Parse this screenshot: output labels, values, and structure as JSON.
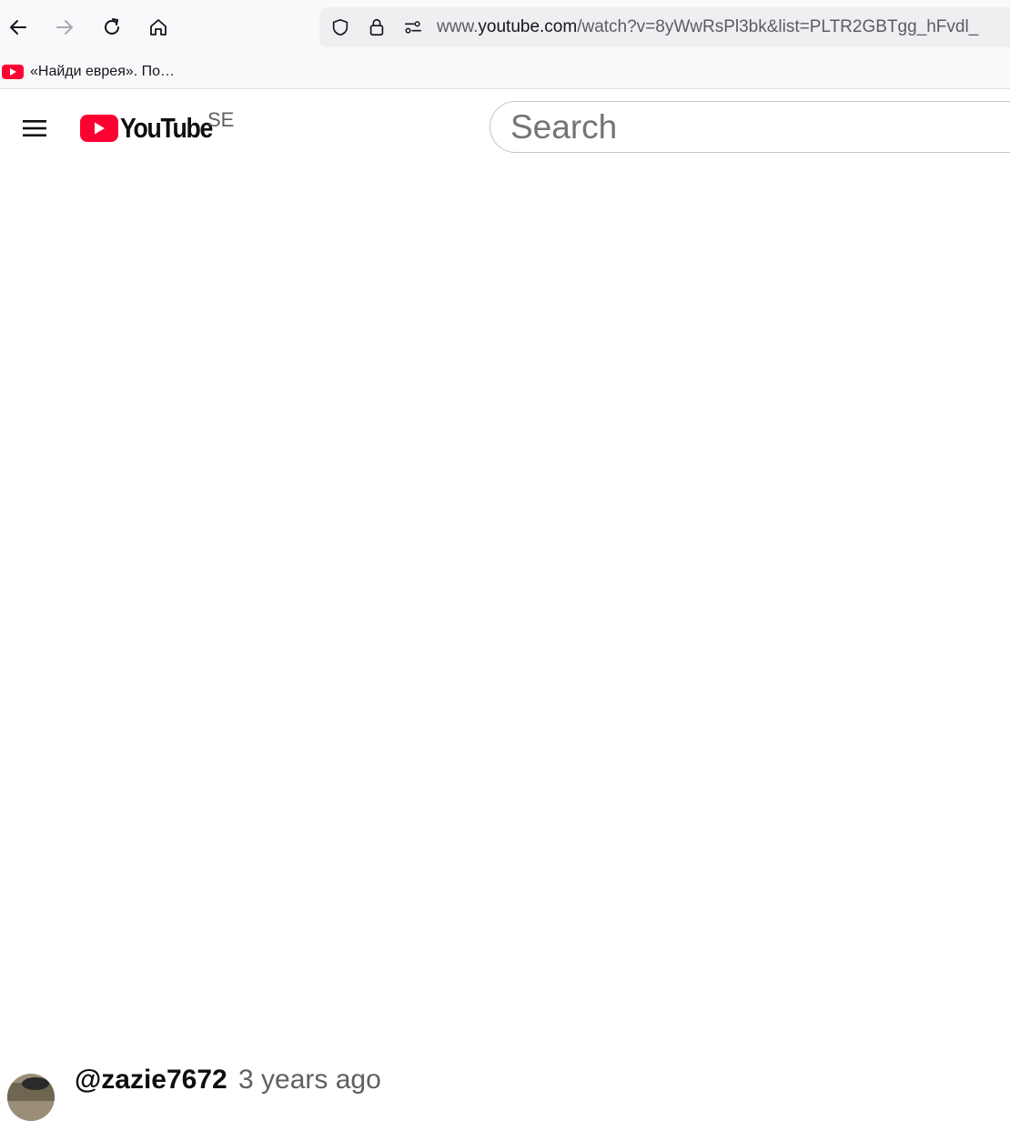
{
  "browser": {
    "url_prefix": "www.",
    "url_host": "youtube.com",
    "url_path": "/watch?v=8yWwRsPl3bk&list=PLTR2GBTgg_hFvdl_",
    "bookmarks": [
      {
        "label": "«Найди еврея». По…",
        "icon": "youtube-favicon"
      }
    ]
  },
  "youtube": {
    "logo_text": "YouTube",
    "country_code": "SE",
    "search_placeholder": "Search",
    "brand_color": "#ff0033"
  },
  "comment": {
    "author": "@zazie7672",
    "time": "3 years ago"
  }
}
